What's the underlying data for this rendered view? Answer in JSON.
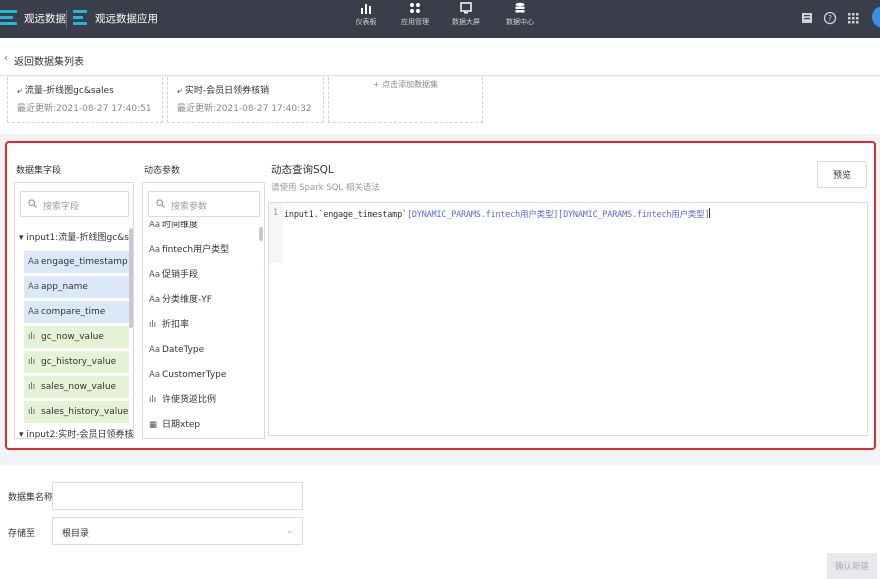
{
  "topbar": {
    "brand": "观远数据",
    "app_name": "观远数据应用",
    "nav": [
      {
        "label": "仪表板",
        "icon": "bar-chart-icon"
      },
      {
        "label": "应用管理",
        "icon": "apps-icon"
      },
      {
        "label": "数据大屏",
        "icon": "screen-icon"
      },
      {
        "label": "数据中心",
        "icon": "database-icon"
      }
    ]
  },
  "breadcrumb": {
    "back_label": "返回数据集列表"
  },
  "datasets": [
    {
      "name": "流量-折线图gc&sales",
      "updated": "最近更新:2021-08-27 17:40:51"
    },
    {
      "name": "实时-会员日领券核销",
      "updated": "最近更新:2021-08-27 17:40:32"
    }
  ],
  "add_dataset_label": "+ 点击添加数据集",
  "fields_panel": {
    "title": "数据集字段",
    "search_placeholder": "搜索字段",
    "groups": [
      "input1:流量-折线图gc&sal···",
      "input2:实时-会员日领券核销"
    ],
    "fields": [
      {
        "icon": "Aa",
        "name": "engage_timestamp",
        "kind": "dim"
      },
      {
        "icon": "Aa",
        "name": "app_name",
        "kind": "dim"
      },
      {
        "icon": "Aa",
        "name": "compare_time",
        "kind": "dim"
      },
      {
        "icon": "ılı",
        "name": "gc_now_value",
        "kind": "mea"
      },
      {
        "icon": "ılı",
        "name": "gc_history_value",
        "kind": "mea"
      },
      {
        "icon": "ılı",
        "name": "sales_now_value",
        "kind": "mea"
      },
      {
        "icon": "ılı",
        "name": "sales_history_value",
        "kind": "mea"
      }
    ]
  },
  "params_panel": {
    "title": "动态参数",
    "search_placeholder": "搜索参数",
    "params": [
      {
        "icon": "Aa",
        "name": "时间维度"
      },
      {
        "icon": "Aa",
        "name": "fintech用户类型"
      },
      {
        "icon": "Aa",
        "name": "促销手段"
      },
      {
        "icon": "Aa",
        "name": "分类维度-YF"
      },
      {
        "icon": "ılı",
        "name": "折扣率"
      },
      {
        "icon": "Aa",
        "name": "DateType"
      },
      {
        "icon": "Aa",
        "name": "CustomerType"
      },
      {
        "icon": "ılı",
        "name": "许使货返比例"
      },
      {
        "icon": "▦",
        "name": "日期xtep"
      }
    ]
  },
  "sql": {
    "title": "动态查询SQL",
    "subtitle": "请使用 Spark SQL 相关语法",
    "preview_label": "预览",
    "line_number": "1",
    "code_prefix": "input1.`engage_timestamp`",
    "param_token_1": "[DYNAMIC_PARAMS.fintech用户类型]",
    "param_token_2": "[DYNAMIC_PARAMS.fintech用户类型]"
  },
  "form": {
    "name_label": "数据集名称",
    "name_value": "",
    "save_label": "存储至",
    "save_value": "根目录",
    "confirm_label": "确认新建"
  }
}
